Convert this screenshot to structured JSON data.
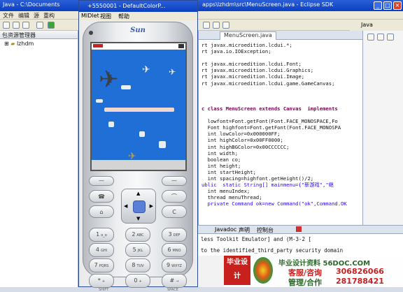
{
  "eclipse": {
    "title_left": "Java - C:\\Documents",
    "title_right": "apps\\lzhdm\\src\\MenuScreen.java - Eclipse SDK",
    "menu": [
      "文件",
      "编辑",
      "源",
      "重构"
    ],
    "perspective": "Java",
    "package_explorer": "包资源管理器",
    "project": "lzhdm",
    "editor_tab": "MenuScreen.java"
  },
  "code_lines": [
    {
      "t": "rt javax.microedition.lcdui.*;",
      "c": "n"
    },
    {
      "t": "rt java.io.IOException;",
      "c": "n"
    },
    {
      "t": "",
      "c": "n"
    },
    {
      "t": "rt javax.microedition.lcdui.Font;",
      "c": "n"
    },
    {
      "t": "rt javax.microedition.lcdui.Graphics;",
      "c": "n"
    },
    {
      "t": "rt javax.microedition.lcdui.Image;",
      "c": "n"
    },
    {
      "t": "rt javax.microedition.lcdui.game.GameCanvas;",
      "c": "n"
    },
    {
      "t": "",
      "c": "n"
    },
    {
      "t": "",
      "c": "n"
    },
    {
      "t": "",
      "c": "n"
    },
    {
      "t": "c class MenuScreen extends Canvas  implements",
      "c": "k"
    },
    {
      "t": "",
      "c": "n"
    },
    {
      "t": "  lowfont=Font.getFont(Font.FACE_MONOSPACE,Fo",
      "c": "n"
    },
    {
      "t": "  Font highfont=Font.getFont(Font.FACE_MONOSPA",
      "c": "n"
    },
    {
      "t": "  int lowColor=0x000000FF;",
      "c": "n"
    },
    {
      "t": "  int highColor=0x00FF0000;",
      "c": "n"
    },
    {
      "t": "  int highBGColor=0x00CCCCCC;",
      "c": "n"
    },
    {
      "t": "  int width;",
      "c": "n"
    },
    {
      "t": "  boolean co;",
      "c": "n"
    },
    {
      "t": "  int height;",
      "c": "n"
    },
    {
      "t": "  int startHeight;",
      "c": "n"
    },
    {
      "t": "  int spacing=highfont.getHeight()/2;",
      "c": "n"
    },
    {
      "t": "ublic  static String[] mainmenu={\"新游戏\",\"继",
      "c": "s"
    },
    {
      "t": "  int menuIndex;",
      "c": "n"
    },
    {
      "t": "  thread menuThread;",
      "c": "n"
    },
    {
      "t": "  private Command ok=new Command(\"ok\",Command.OK",
      "c": "s"
    }
  ],
  "console": {
    "tabs": [
      "Javadoc",
      "声明",
      "控制台"
    ],
    "line1": "less Toolkit Emulator] and (M-3-2 [",
    "line2": "to the identified_third_party security domain"
  },
  "emulator": {
    "title": "+5550001 - DefaultColorP...",
    "menu": [
      "MIDlet",
      "视图",
      "帮助"
    ],
    "brand": "Sun",
    "keys": [
      {
        "label": "1",
        "sub": "o_o"
      },
      {
        "label": "2",
        "sub": "ABC"
      },
      {
        "label": "3",
        "sub": "DEF"
      },
      {
        "label": "4",
        "sub": "GHI"
      },
      {
        "label": "5",
        "sub": "JKL"
      },
      {
        "label": "6",
        "sub": "MNO"
      },
      {
        "label": "7",
        "sub": "PQRS"
      },
      {
        "label": "8",
        "sub": "TUV"
      },
      {
        "label": "9",
        "sub": "WXYZ"
      },
      {
        "label": "*",
        "sub": "+"
      },
      {
        "label": "0",
        "sub": "+"
      },
      {
        "label": "#",
        "sub": "→"
      }
    ],
    "shift_label": "SHIFT",
    "space_label": "SPACE"
  },
  "ad": {
    "brand": "毕业设计",
    "site": "毕业设计资料 56DOC.COM",
    "line1_label": "客服/咨询",
    "line1_phone": "306826066",
    "line2_label": "管理/合作",
    "line2_phone": "281788421"
  }
}
